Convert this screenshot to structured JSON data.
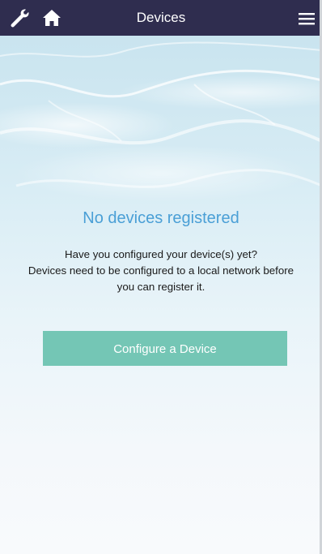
{
  "navbar": {
    "title": "Devices",
    "left_icons": [
      "wrench-icon",
      "home-icon"
    ],
    "right_icon": "hamburger-menu-icon",
    "background_color": "#2f2d4f"
  },
  "empty_state": {
    "title": "No devices registered",
    "line1": "Have you configured your device(s) yet?",
    "line2": "Devices need to be configured to a local network before",
    "line3": "you can register it.",
    "title_color": "#4a9fd6"
  },
  "actions": {
    "configure_label": "Configure a Device",
    "button_color": "#74c6b5"
  }
}
